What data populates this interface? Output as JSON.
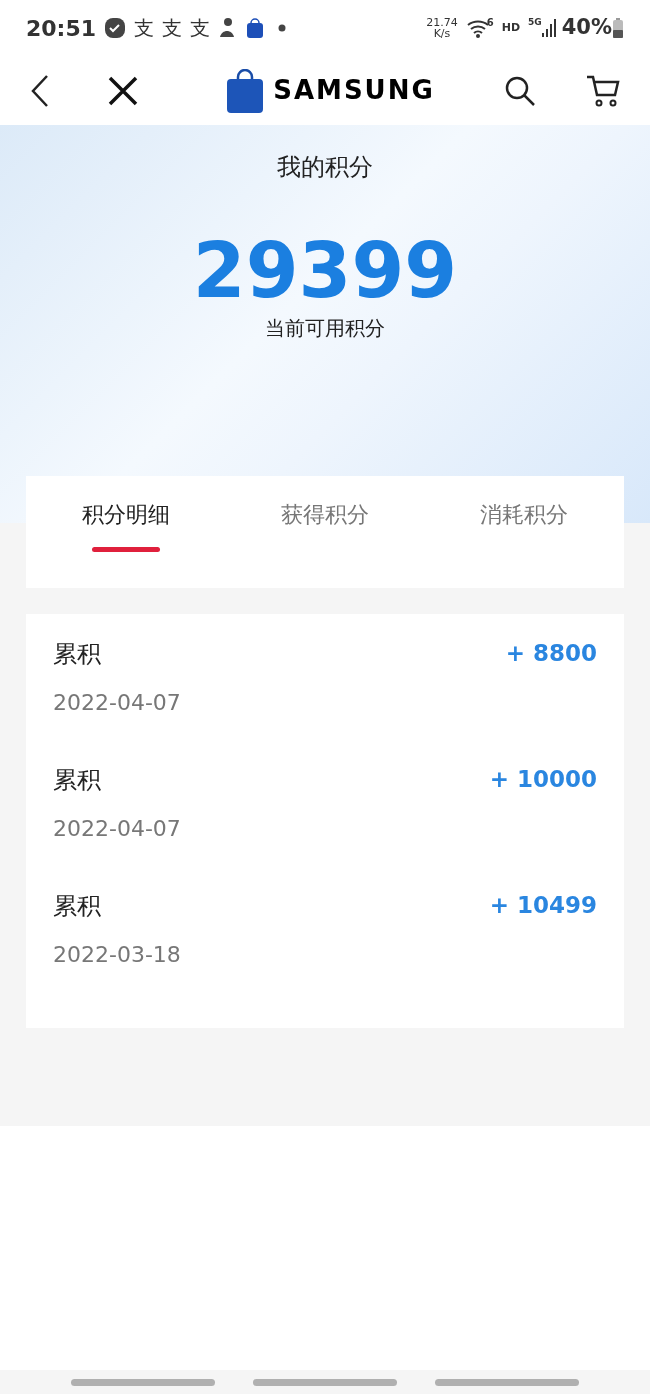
{
  "status_bar": {
    "time": "20:51",
    "notifications": [
      "支",
      "支",
      "支"
    ],
    "speed": "21.74",
    "speed_unit": "K/s",
    "wifi_label": "6",
    "hd": "HD",
    "network": "5G",
    "battery": "40%"
  },
  "header": {
    "brand": "SAMSUNG"
  },
  "hero": {
    "title": "我的积分",
    "points": "29399",
    "caption": "当前可用积分"
  },
  "tabs": [
    {
      "label": "积分明细",
      "selected": true
    },
    {
      "label": "获得积分",
      "selected": false
    },
    {
      "label": "消耗积分",
      "selected": false
    }
  ],
  "records": [
    {
      "type": "累积",
      "date": "2022-04-07",
      "amount": "+ 8800"
    },
    {
      "type": "累积",
      "date": "2022-04-07",
      "amount": "+ 10000"
    },
    {
      "type": "累积",
      "date": "2022-03-18",
      "amount": "+ 10499"
    }
  ]
}
